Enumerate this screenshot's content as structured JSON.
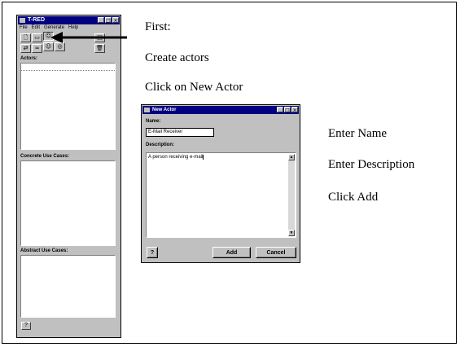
{
  "tred_window": {
    "title": "T-RED",
    "menu": [
      "File",
      "Edit",
      "Generate",
      "Help"
    ],
    "actors_label": "Actors:",
    "concrete_label": "Concrete Use Cases:",
    "abstract_label": "Abstract Use Cases:",
    "help_label": "?"
  },
  "slide": {
    "first": "First:",
    "create_actors": "Create actors",
    "click_new_actor": "Click on New Actor",
    "enter_name": "Enter Name",
    "enter_description": "Enter Description",
    "click_add": "Click Add"
  },
  "dialog": {
    "title": "New Actor",
    "name_label": "Name:",
    "name_value": "E-Mail Receiver",
    "description_label": "Description:",
    "description_value": "A person receiving e-mail",
    "help_label": "?",
    "add_label": "Add",
    "cancel_label": "Cancel"
  },
  "window_controls": {
    "minimize": "_",
    "maximize": "□",
    "close": "×"
  },
  "colors": {
    "titlebar": "#000080",
    "window": "#c0c0c0",
    "arrow": "#000000"
  }
}
